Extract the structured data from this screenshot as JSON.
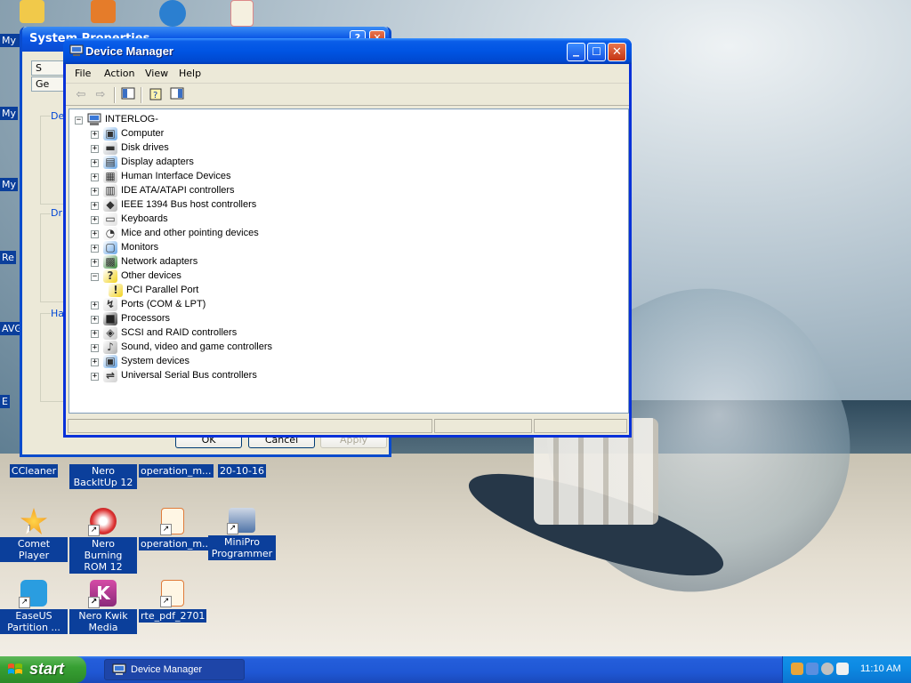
{
  "desktop": {
    "left_labels": [
      "My I",
      "My",
      "My",
      "Re",
      "AVG",
      "E"
    ],
    "icons": [
      {
        "label": "CCleaner"
      },
      {
        "label": "Nero BackItUp 12"
      },
      {
        "label": "operation_m..."
      },
      {
        "label": "20-10-16"
      },
      {
        "label": "Comet Player"
      },
      {
        "label": "Nero Burning ROM 12"
      },
      {
        "label": "operation_m..."
      },
      {
        "label": "MiniPro Programmer"
      },
      {
        "label": "EaseUS Partition ..."
      },
      {
        "label": "Nero Kwik Media"
      },
      {
        "label": "rte_pdf_2701"
      }
    ]
  },
  "system_properties": {
    "title": "System Properties",
    "tab_1": "S",
    "tab_2": "Ge",
    "group_1": "De",
    "group_2": "Dri",
    "group_3": "Ha",
    "ok_label": "OK",
    "cancel_label": "Cancel",
    "apply_label": "Apply"
  },
  "device_manager": {
    "title": "Device Manager",
    "menu": {
      "file": "File",
      "action": "Action",
      "view": "View",
      "help": "Help"
    },
    "root": "INTERLOG-",
    "tree": [
      {
        "label": "Computer",
        "icon": "computer-icon",
        "expanded": false
      },
      {
        "label": "Disk drives",
        "icon": "disk-drive-icon",
        "expanded": false
      },
      {
        "label": "Display adapters",
        "icon": "display-adapter-icon",
        "expanded": false
      },
      {
        "label": "Human Interface Devices",
        "icon": "hid-icon",
        "expanded": false
      },
      {
        "label": "IDE ATA/ATAPI controllers",
        "icon": "ide-controller-icon",
        "expanded": false
      },
      {
        "label": "IEEE 1394 Bus host controllers",
        "icon": "ieee1394-icon",
        "expanded": false
      },
      {
        "label": "Keyboards",
        "icon": "keyboard-icon",
        "expanded": false
      },
      {
        "label": "Mice and other pointing devices",
        "icon": "mouse-icon",
        "expanded": false
      },
      {
        "label": "Monitors",
        "icon": "monitor-icon",
        "expanded": false
      },
      {
        "label": "Network adapters",
        "icon": "network-adapter-icon",
        "expanded": false
      },
      {
        "label": "Other devices",
        "icon": "unknown-device-icon",
        "expanded": true
      },
      {
        "label": "PCI Parallel Port",
        "icon": "warning-device-icon",
        "child": true
      },
      {
        "label": "Ports (COM & LPT)",
        "icon": "port-icon",
        "expanded": false
      },
      {
        "label": "Processors",
        "icon": "processor-icon",
        "expanded": false
      },
      {
        "label": "SCSI and RAID controllers",
        "icon": "scsi-icon",
        "expanded": false
      },
      {
        "label": "Sound, video and game controllers",
        "icon": "sound-icon",
        "expanded": false
      },
      {
        "label": "System devices",
        "icon": "system-device-icon",
        "expanded": false
      },
      {
        "label": "Universal Serial Bus controllers",
        "icon": "usb-icon",
        "expanded": false
      }
    ]
  },
  "taskbar": {
    "start_label": "start",
    "task_label": "Device Manager",
    "clock": "11:10 AM"
  },
  "colors": {
    "title_blue": "#0054e3",
    "taskbar_blue": "#245edb",
    "start_green": "#37a033"
  }
}
